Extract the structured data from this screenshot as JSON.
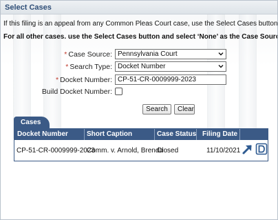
{
  "header": {
    "title": "Select Cases"
  },
  "intro": {
    "line1": "If this filing is an appeal from any Common Pleas Court case, use the Select Cases button to search",
    "line2": "For all other cases. use the Select Cases button and select ‘None’ as the Case Source."
  },
  "form": {
    "case_source": {
      "label": "Case Source:",
      "value": "Pennsylvania Court"
    },
    "search_type": {
      "label": "Search Type:",
      "value": "Docket Number"
    },
    "docket_number": {
      "label": "Docket Number:",
      "value": "CP-51-CR-0009999-2023"
    },
    "build_docket": {
      "label": "Build Docket Number:"
    },
    "required_mark": "*"
  },
  "buttons": {
    "search": "Search",
    "clear": "Clear"
  },
  "cases": {
    "tab_label": "Cases",
    "columns": [
      "Docket Number",
      "Short Caption",
      "Case Status",
      "Filing Date"
    ],
    "rows": [
      {
        "docket": "CP-51-CR-0009999-2023",
        "caption": "Comm. v. Arnold, Brenda",
        "status": "Closed",
        "date": "11/10/2021"
      }
    ]
  },
  "icons": {
    "open": "arrow-up-right-icon",
    "docket": "d-letter-icon"
  },
  "colors": {
    "accent": "#3b5a86",
    "header_text": "#2f4e77",
    "required": "#c0392b"
  }
}
